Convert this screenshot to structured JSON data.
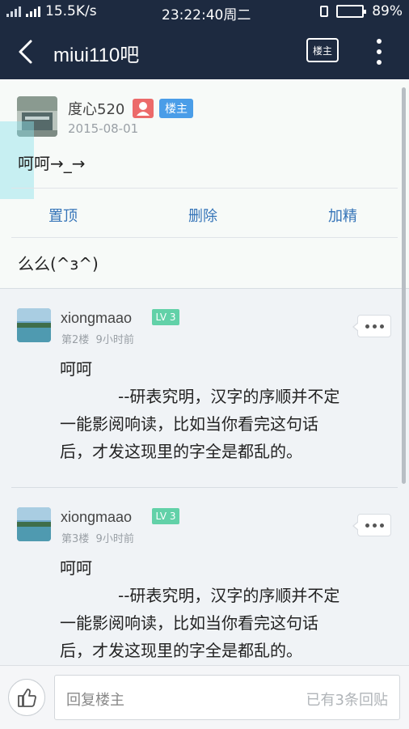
{
  "status_bar": {
    "net_speed": "15.5K/s",
    "time": "23:22:40周二",
    "battery": "89%",
    "battery_level": 0.89
  },
  "header": {
    "title": "miui110吧",
    "louzhu_button": "楼主",
    "icons": [
      "back-arrow-icon",
      "more-vert-icon"
    ]
  },
  "main_post": {
    "author": "度心520",
    "badge": "楼主",
    "date": "2015-08-01",
    "content": "呵呵→_→",
    "actions": {
      "pin": "置顶",
      "delete": "删除",
      "feature": "加精"
    },
    "sub_reply": "么么(^з^)"
  },
  "replies": [
    {
      "username": "xiongmaao",
      "level": "LV 3",
      "floor": "第2楼",
      "time_ago": "9小时前",
      "line1": "呵呵",
      "line2": "--研表究明，汉字的序顺并不定",
      "line3": "一能影阅响读，比如当你看完这句话",
      "line4": "后，才发这现里的字全是都乱的。"
    },
    {
      "username": "xiongmaao",
      "level": "LV 3",
      "floor": "第3楼",
      "time_ago": "9小时前",
      "line1": "呵呵",
      "line2": "--研表究明，汉字的序顺并不定",
      "line3": "一能影阅响读，比如当你看完这句话",
      "line4": "后，才发这现里的字全是都乱的。"
    }
  ],
  "bottom_bar": {
    "placeholder": "回复楼主",
    "reply_count": "已有3条回贴"
  },
  "colors": {
    "header_bg": "#1d2a40",
    "link_blue": "#3574b8",
    "badge_blue": "#4a9de8",
    "level_green": "#62d1a8",
    "user_red": "#ec6a6a"
  }
}
